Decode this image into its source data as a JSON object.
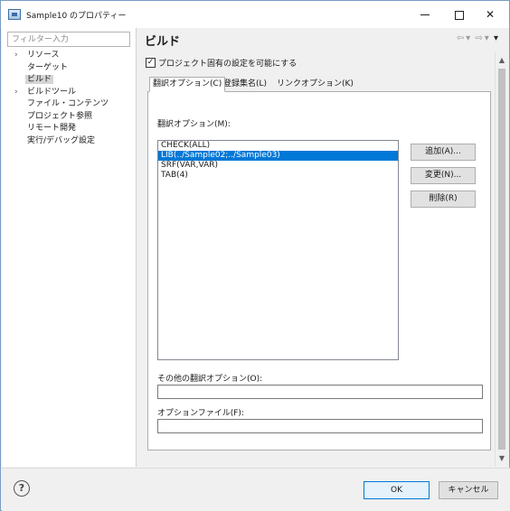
{
  "window": {
    "title": "Sample10 のプロパティー",
    "app_icon": "project-properties-icon",
    "controls": {
      "minimize": "minimize-icon",
      "maximize": "maximize-icon",
      "close": "✕"
    }
  },
  "sidebar": {
    "filter_placeholder": "フィルター入力",
    "items": [
      {
        "label": "リソース",
        "expander": "›",
        "selected": false
      },
      {
        "label": "ターゲット",
        "expander": "",
        "selected": false
      },
      {
        "label": "ビルド",
        "expander": "",
        "selected": true
      },
      {
        "label": "ビルドツール",
        "expander": "›",
        "selected": false
      },
      {
        "label": "ファイル・コンテンツ",
        "expander": "",
        "selected": false
      },
      {
        "label": "プロジェクト参照",
        "expander": "",
        "selected": false
      },
      {
        "label": "リモート開発",
        "expander": "",
        "selected": false
      },
      {
        "label": "実行/デバッグ設定",
        "expander": "",
        "selected": false
      }
    ]
  },
  "page": {
    "title": "ビルド",
    "nav": {
      "back": "⇦",
      "back_menu": "▾",
      "forward": "⇨",
      "forward_menu": "▾",
      "view_menu": "▾"
    }
  },
  "settings": {
    "enable_project_specific": {
      "label": "プロジェクト固有の設定を可能にする",
      "checked": true,
      "mark": "✓"
    },
    "tabs": [
      {
        "label": "翻訳オプション(C)",
        "active": true
      },
      {
        "label": "登録集名(L)",
        "active": false
      },
      {
        "label": "リンクオプション(K)",
        "active": false
      }
    ],
    "compile_options": {
      "label": "翻訳オプション(M):",
      "items": [
        "CHECK(ALL)",
        "LIB(../Sample02;../Sample03)",
        "SRF(VAR,VAR)",
        "TAB(4)"
      ],
      "selected_index": 1
    },
    "buttons": {
      "add": "追加(A)...",
      "edit": "変更(N)...",
      "delete": "削除(R)"
    },
    "other_options": {
      "label": "その他の翻訳オプション(O):",
      "value": ""
    },
    "option_file": {
      "label": "オプションファイル(F):",
      "value": ""
    }
  },
  "footer": {
    "help": "?",
    "ok": "OK",
    "cancel": "キャンセル"
  },
  "scrollbar": {
    "up": "▲",
    "down": "▼"
  }
}
